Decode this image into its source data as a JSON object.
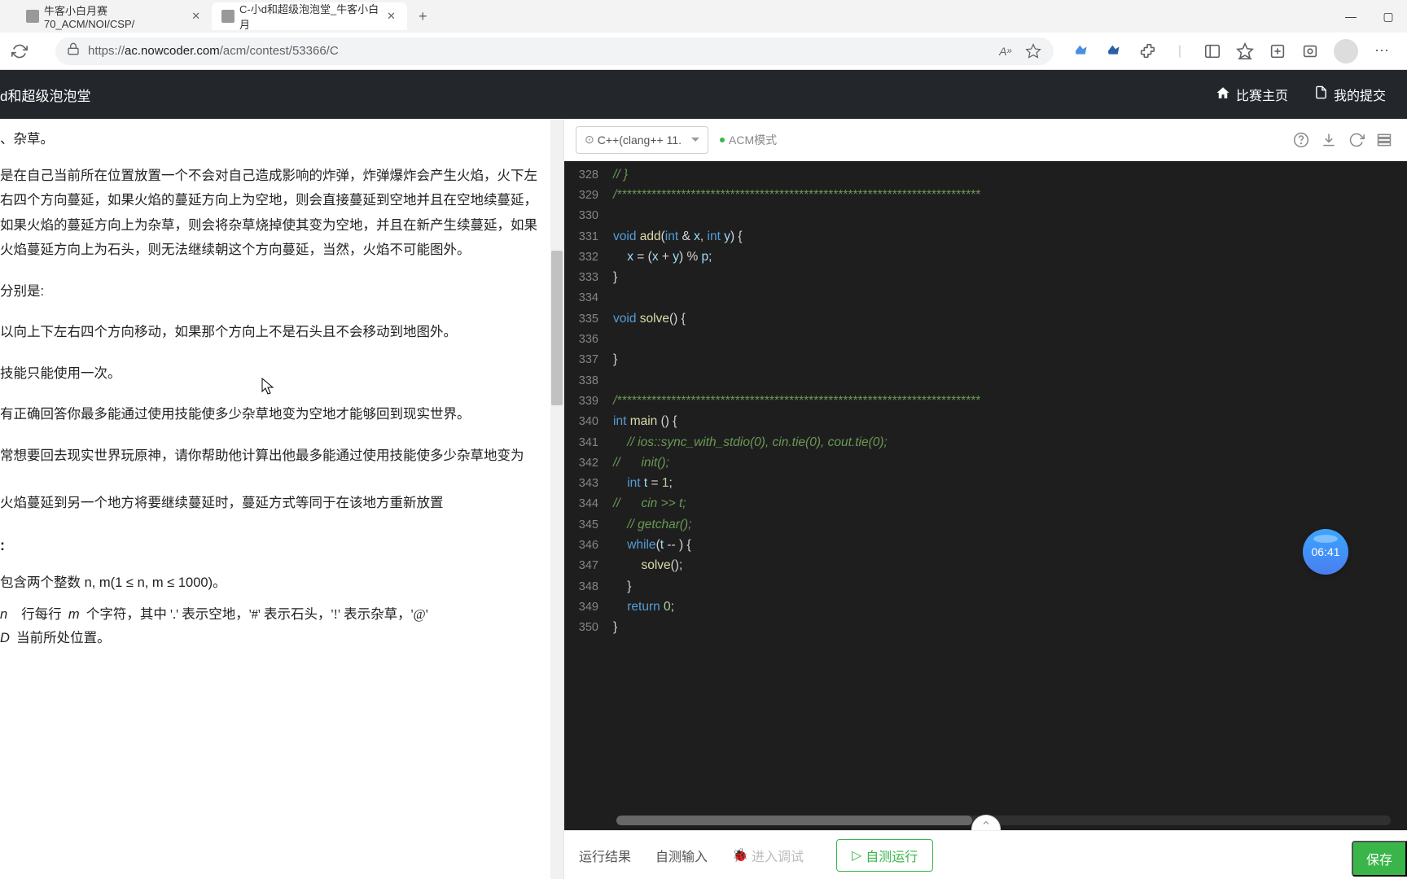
{
  "browser": {
    "tabs": [
      {
        "title": "牛客小白月赛70_ACM/NOI/CSP/"
      },
      {
        "title": "C-小d和超级泡泡堂_牛客小白月"
      }
    ],
    "url_prefix": "https://",
    "url_domain": "ac.nowcoder.com",
    "url_path": "/acm/contest/53366/C"
  },
  "header": {
    "title": "d和超级泡泡堂",
    "home": "比赛主页",
    "submissions": "我的提交"
  },
  "problem": {
    "frag0": "、杂草。",
    "p1": "是在自己当前所在位置放置一个不会对自己造成影响的炸弹，炸弹爆炸会产生火焰，火下左右四个方向蔓延，如果火焰的蔓延方向上为空地，则会直接蔓延到空地并且在空地续蔓延，如果火焰的蔓延方向上为杂草，则会将杂草烧掉使其变为空地，并且在新产生续蔓延，如果火焰蔓延方向上为石头，则无法继续朝这个方向蔓延，当然，火焰不可能图外。",
    "p2": "分别是:",
    "p3": "以向上下左右四个方向移动，如果那个方向上不是石头且不会移动到地图外。",
    "p4": "技能只能使用一次。",
    "p5": "有正确回答你最多能通过使用技能使多少杂草地变为空地才能够回到现实世界。",
    "p6": "常想要回去现实世界玩原神，请你帮助他计算出他最多能通过使用技能使多少杂草地变为",
    "p7": "火焰蔓延到另一个地方将要继续蔓延时，蔓延方式等同于在该地方重新放置",
    "p8": ":",
    "p9": "包含两个整数  n, m(1 ≤ n, m ≤ 1000)。",
    "p10a": "n  行每行  m  个字符，其中 '.' 表示空地，'#' 表示石头，'!' 表示杂草，'@'",
    "p10b": "D  当前所处位置。"
  },
  "editor": {
    "language": "C++(clang++ 11.",
    "mode": "ACM模式",
    "timer": "06:41",
    "lines": [
      {
        "n": 328,
        "html": "<span class='cm'>// }</span>"
      },
      {
        "n": 329,
        "html": "<span class='cm'>/**************************************************************************</span>"
      },
      {
        "n": 330,
        "html": ""
      },
      {
        "n": 331,
        "html": "<span class='kw'>void</span> <span class='fn'>add</span>(<span class='ty'>int</span> &amp; <span class='id'>x</span>, <span class='ty'>int</span> <span class='id'>y</span>) {"
      },
      {
        "n": 332,
        "html": "    <span class='id'>x</span> = (<span class='id'>x</span> + <span class='id'>y</span>) % <span class='id'>p</span>;"
      },
      {
        "n": 333,
        "html": "}"
      },
      {
        "n": 334,
        "html": ""
      },
      {
        "n": 335,
        "html": "<span class='kw'>void</span> <span class='fn'>solve</span>() {"
      },
      {
        "n": 336,
        "html": ""
      },
      {
        "n": 337,
        "html": "}"
      },
      {
        "n": 338,
        "html": ""
      },
      {
        "n": 339,
        "html": "<span class='cm'>/**************************************************************************</span>"
      },
      {
        "n": 340,
        "html": "<span class='ty'>int</span> <span class='fn'>main</span> () {"
      },
      {
        "n": 341,
        "html": "    <span class='cm'>// ios::sync_with_stdio(0), cin.tie(0), cout.tie(0);</span>"
      },
      {
        "n": 342,
        "html": "<span class='cm'>//      init();</span>"
      },
      {
        "n": 343,
        "html": "    <span class='ty'>int</span> <span class='id'>t</span> = <span class='nm'>1</span>;"
      },
      {
        "n": 344,
        "html": "<span class='cm'>//      cin &gt;&gt; t;</span>"
      },
      {
        "n": 345,
        "html": "    <span class='cm'>// getchar();</span>"
      },
      {
        "n": 346,
        "html": "    <span class='kw'>while</span>(<span class='id'>t</span> -- ) {"
      },
      {
        "n": 347,
        "html": "        <span class='fn'>solve</span>();"
      },
      {
        "n": 348,
        "html": "    }"
      },
      {
        "n": 349,
        "html": "    <span class='kw'>return</span> <span class='nm'>0</span>;"
      },
      {
        "n": 350,
        "html": "}"
      }
    ]
  },
  "bottom": {
    "tab_result": "运行结果",
    "tab_input": "自测输入",
    "tab_debug": "进入调试",
    "btn_test": "自测运行",
    "btn_save": "保存"
  }
}
